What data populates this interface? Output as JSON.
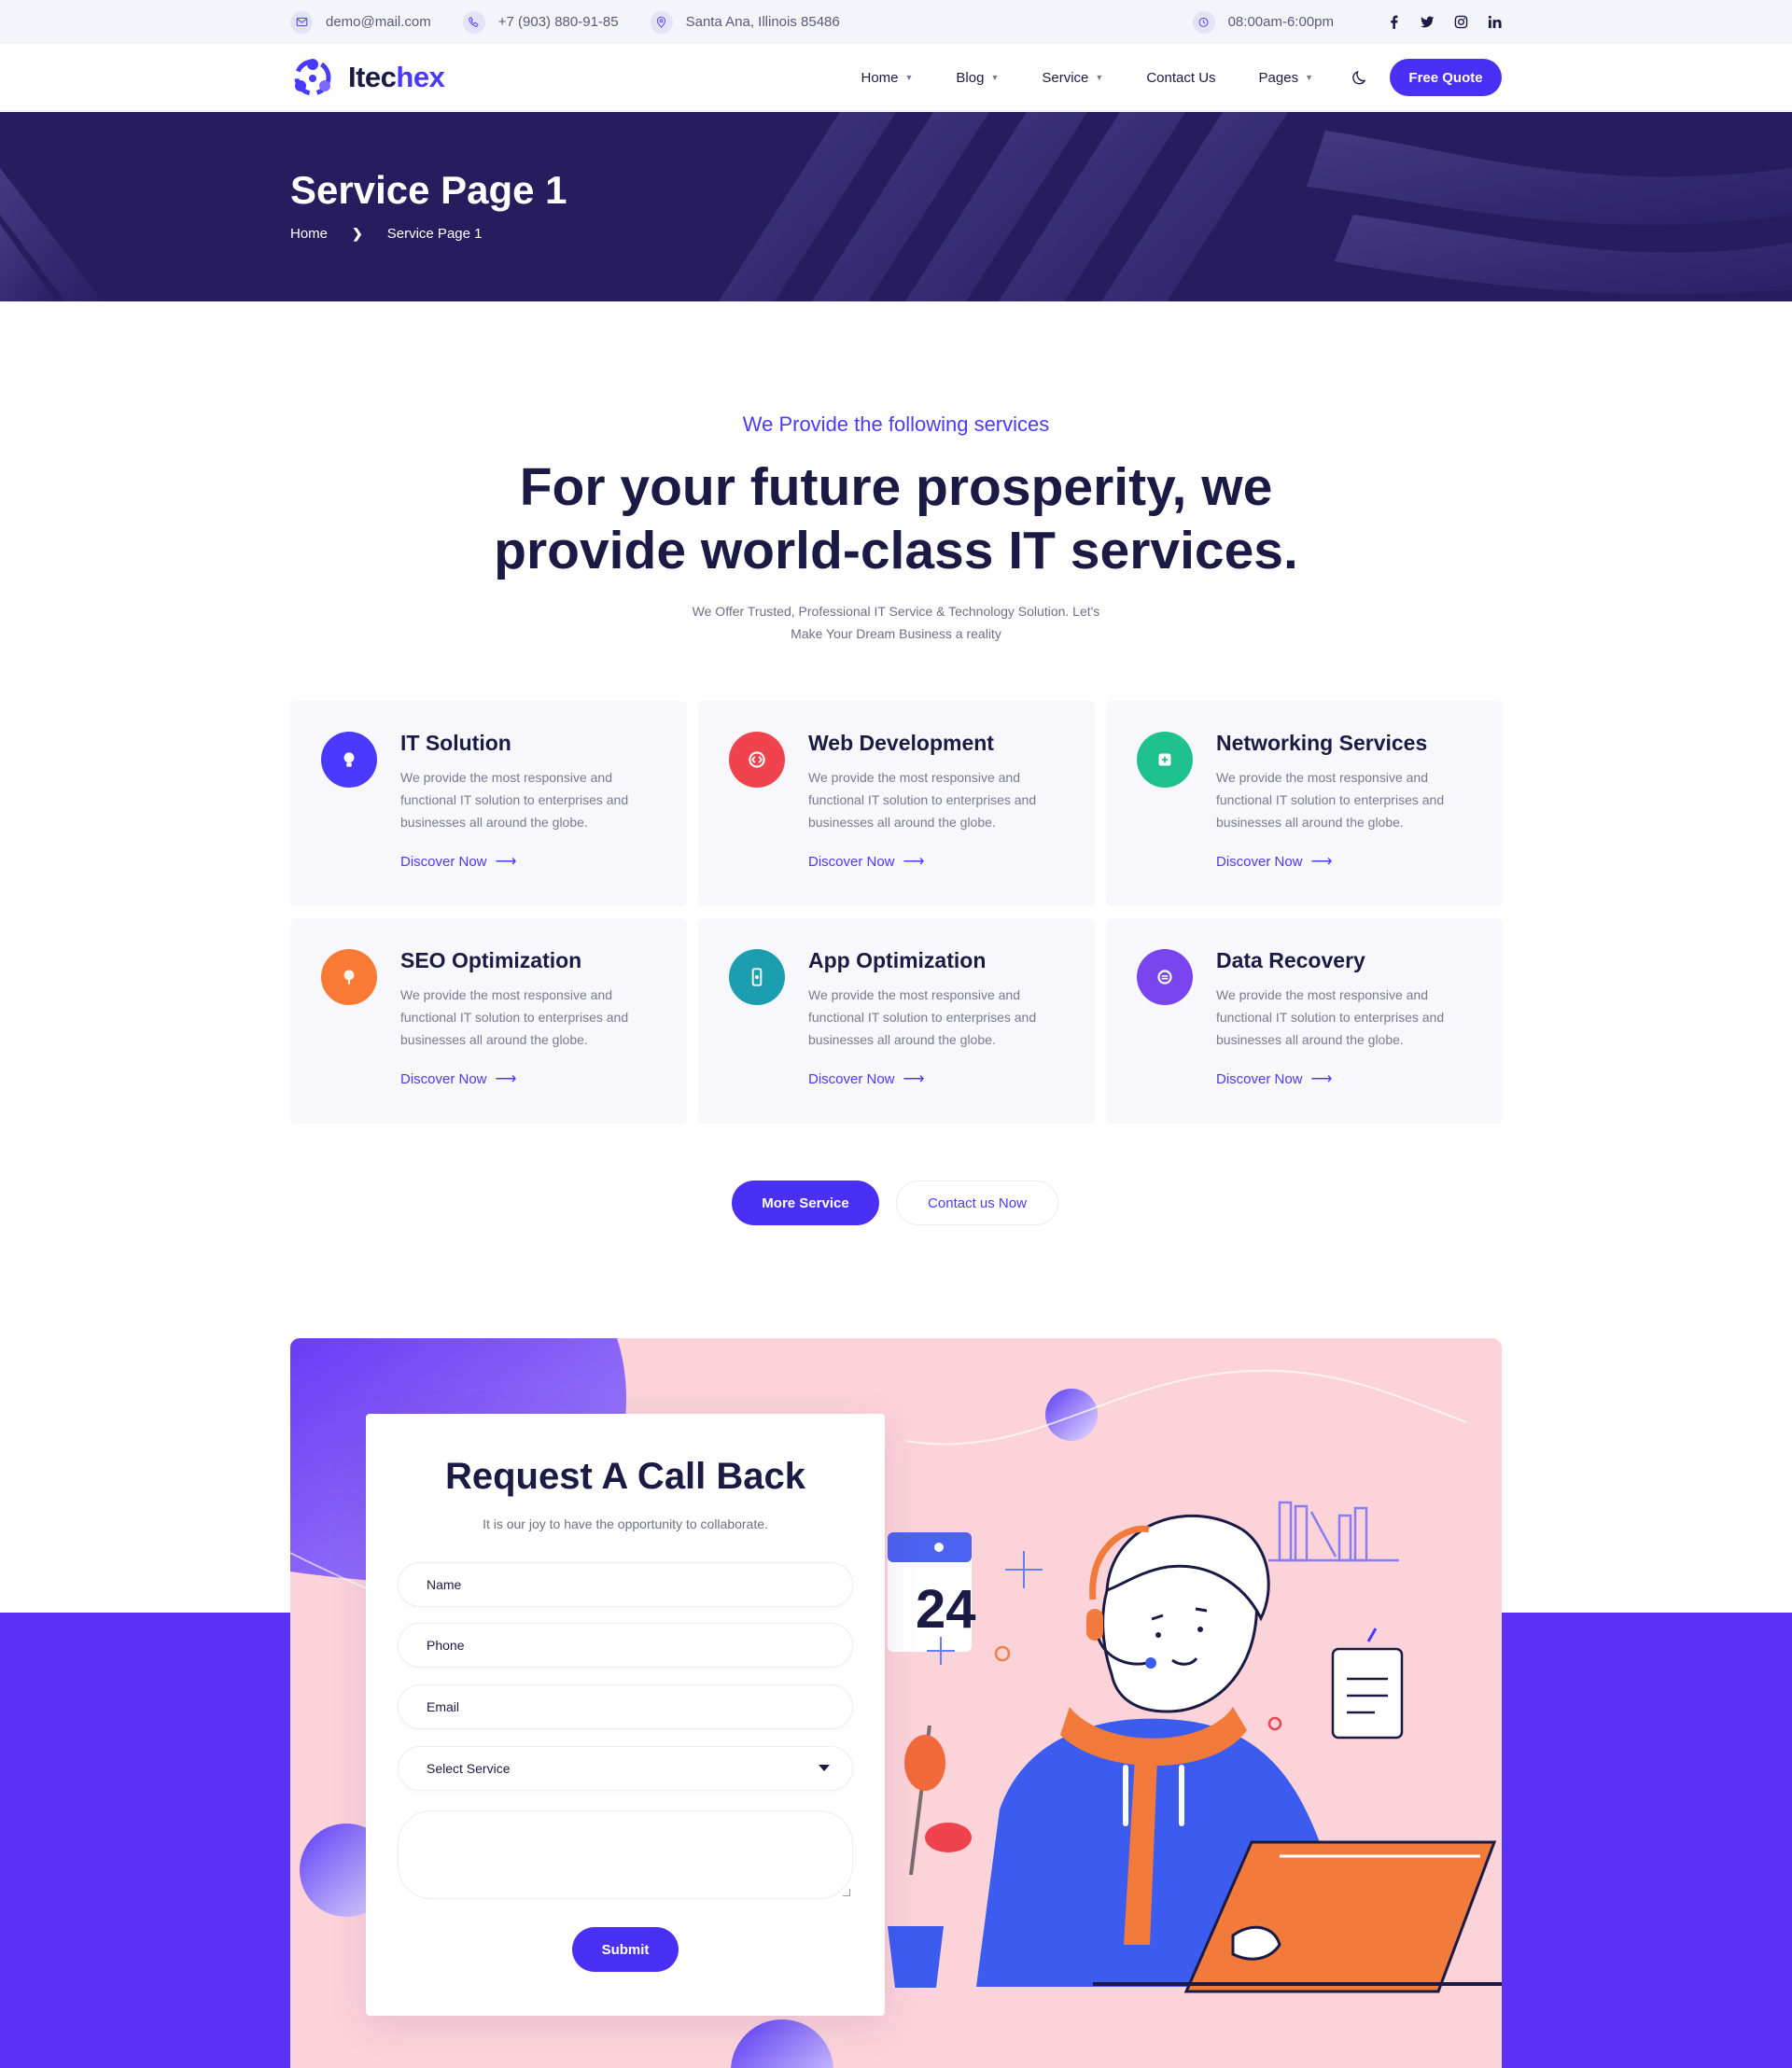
{
  "topbar": {
    "email": "demo@mail.com",
    "phone": "+7 (903) 880-91-85",
    "address": "Santa Ana, Illinois 85486",
    "hours": "08:00am-6:00pm",
    "social": [
      "facebook-icon",
      "twitter-icon",
      "instagram-icon",
      "linkedin-icon"
    ]
  },
  "header": {
    "logo_main": "Itec",
    "logo_accent": "hex",
    "nav": [
      {
        "label": "Home",
        "dropdown": true
      },
      {
        "label": "Blog",
        "dropdown": true
      },
      {
        "label": "Service",
        "dropdown": true
      },
      {
        "label": "Contact Us",
        "dropdown": false
      },
      {
        "label": "Pages",
        "dropdown": true
      }
    ],
    "cta": "Free Quote"
  },
  "hero": {
    "title": "Service Page 1",
    "breadcrumb": {
      "home": "Home",
      "current": "Service Page 1"
    }
  },
  "services": {
    "subtitle": "We Provide the following services",
    "title_line1": "For your future prosperity, we",
    "title_line2": "provide world-class IT services.",
    "desc_line1": "We Offer Trusted, Professional IT Service & Technology Solution. Let's",
    "desc_line2": "Make Your Dream Business a reality",
    "items": [
      {
        "title": "IT Solution",
        "text": "We provide the most responsive and functional IT solution to enterprises and businesses all around the globe.",
        "link": "Discover Now",
        "color": "#4a3aff",
        "icon": "lightbulb-icon"
      },
      {
        "title": "Web Development",
        "text": "We provide the most responsive and functional IT solution to enterprises and businesses all around the globe.",
        "link": "Discover Now",
        "color": "#f0434e",
        "icon": "code-icon"
      },
      {
        "title": "Networking Services",
        "text": "We provide the most responsive and functional IT solution to enterprises and businesses all around the globe.",
        "link": "Discover Now",
        "color": "#1fc28c",
        "icon": "network-icon"
      },
      {
        "title": "SEO Optimization",
        "text": "We provide the most responsive and functional IT solution to enterprises and businesses all around the globe.",
        "link": "Discover Now",
        "color": "#fa7a35",
        "icon": "seo-icon"
      },
      {
        "title": "App Optimization",
        "text": "We provide the most responsive and functional IT solution to enterprises and businesses all around the globe.",
        "link": "Discover Now",
        "color": "#1b9fb0",
        "icon": "mobile-icon"
      },
      {
        "title": "Data Recovery",
        "text": "We provide the most responsive and functional IT solution to enterprises and businesses all around the globe.",
        "link": "Discover Now",
        "color": "#7a45ef",
        "icon": "recovery-icon"
      }
    ],
    "btn_more": "More Service",
    "btn_contact": "Contact us Now"
  },
  "callback": {
    "title": "Request A Call Back",
    "subtitle": "It is our joy to have the opportunity to collaborate.",
    "name_placeholder": "Name",
    "phone_placeholder": "Phone",
    "email_placeholder": "Email",
    "select_label": "Select Service",
    "submit": "Submit",
    "calendar_number": "24"
  }
}
